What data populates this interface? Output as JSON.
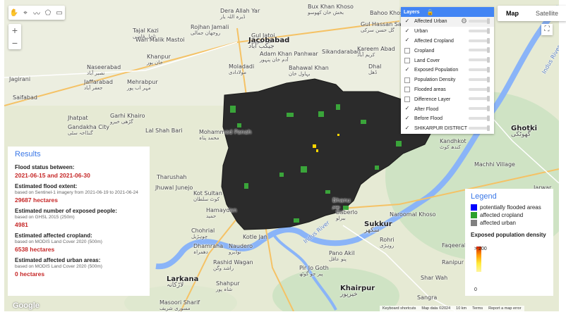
{
  "map": {
    "places": [
      {
        "en": "Dera Allah Yar",
        "ur": "ڈیرہ اللہ یار"
      },
      {
        "en": "Rojhan Jamali",
        "ur": "روجھان جمالی"
      },
      {
        "en": "Gul Jatoi",
        "ur": "گل جتوئی"
      },
      {
        "en": "Jacobabad",
        "ur": "جیکب آباد"
      },
      {
        "en": "Adam Khan Panhwar",
        "ur": "آدم خان پنہور"
      },
      {
        "en": "Moladadi",
        "ur": "مولادادی"
      },
      {
        "en": "Bahawal Khan",
        "ur": "بہاول خان"
      },
      {
        "en": "Sikandarabad",
        "ur": ""
      },
      {
        "en": "Kareem Abad",
        "ur": "کریم آباد"
      },
      {
        "en": "Dhal",
        "ur": "ڈھل"
      },
      {
        "en": "Bux Khan Khoso",
        "ur": "بخش خان کھوسو"
      },
      {
        "en": "Bahoo Khosa",
        "ur": ""
      },
      {
        "en": "Gul Hassan Sarki",
        "ur": "گل حسن سرکی"
      },
      {
        "en": "Tajal Kazi",
        "ur": "تاجل قاضی"
      },
      {
        "en": "Wah Malik Mastoi",
        "ur": ""
      },
      {
        "en": "Khanpur",
        "ur": "خان پور"
      },
      {
        "en": "Naseerabad",
        "ur": "نصیر آباد"
      },
      {
        "en": "Jaffarabad",
        "ur": "جعفر آباد"
      },
      {
        "en": "Mehrabpur",
        "ur": "مہر اب پور"
      },
      {
        "en": "Jagirani",
        "ur": ""
      },
      {
        "en": "Saifabad",
        "ur": ""
      },
      {
        "en": "Garhi Khairo",
        "ur": "گڑھی خیرو"
      },
      {
        "en": "Gandakha City",
        "ur": "گنڈاخہ سٹی"
      },
      {
        "en": "Jhatpat",
        "ur": ""
      },
      {
        "en": "Lal Shah Bari",
        "ur": ""
      },
      {
        "en": "Mohammad Panah",
        "ur": "محمد پناہ"
      },
      {
        "en": "Tharushah",
        "ur": ""
      },
      {
        "en": "Jhuwal Junejo",
        "ur": ""
      },
      {
        "en": "Kot Sultan",
        "ur": "کوٹ سلطان"
      },
      {
        "en": "Hamaydan",
        "ur": "حمید"
      },
      {
        "en": "Dhamraha",
        "ur": "دھمراہ"
      },
      {
        "en": "Chohrial",
        "ur": "چوہڑیل"
      },
      {
        "en": "Kotle Jan",
        "ur": ""
      },
      {
        "en": "Naudero",
        "ur": "نوڈیرو"
      },
      {
        "en": "Rashid Wagan",
        "ur": "راشد وگن"
      },
      {
        "en": "Larkana",
        "ur": "لاڑکانہ"
      },
      {
        "en": "Shahpur",
        "ur": "شاہ پور"
      },
      {
        "en": "Masoori Sharif",
        "ur": "مسوری شریف"
      },
      {
        "en": "Sukkur",
        "ur": "سکھر"
      },
      {
        "en": "Rohri",
        "ur": "روہڑی"
      },
      {
        "en": "Pano Akil",
        "ur": "پنو عاقل"
      },
      {
        "en": "Pir Jo Goth",
        "ur": "پیر جو گوٹھ"
      },
      {
        "en": "Khairpur",
        "ur": "خیرپور"
      },
      {
        "en": "Naroomal Khoso",
        "ur": ""
      },
      {
        "en": "Faqeerabad",
        "ur": ""
      },
      {
        "en": "Ghotki",
        "ur": "گھوٹکی"
      },
      {
        "en": "Machhi Village",
        "ur": ""
      },
      {
        "en": "Jarwar",
        "ur": ""
      },
      {
        "en": "Ranipur",
        "ur": ""
      },
      {
        "en": "Shar Wah",
        "ur": ""
      },
      {
        "en": "Sangra",
        "ur": ""
      },
      {
        "en": "Kandhkot",
        "ur": "کندھ کوٹ"
      },
      {
        "en": "Bhanu",
        "ur": "بھنو"
      },
      {
        "en": "Baberlo",
        "ur": "ببرلو"
      }
    ],
    "roads": [
      "N65",
      "N55",
      "N65",
      "N105",
      "N55"
    ],
    "river_label": "Indus River",
    "footer": {
      "shortcuts": "Keyboard shortcuts",
      "data": "Map data ©2024",
      "scale": "10 km",
      "terms": "Terms",
      "report": "Report a map error"
    },
    "logo": "Google"
  },
  "controls": {
    "zoom_in": "+",
    "zoom_out": "−",
    "map_label": "Map",
    "satellite_label": "Satellite"
  },
  "layers": {
    "title": "Layers",
    "items": [
      {
        "label": "Affected Urban",
        "checked": true
      },
      {
        "label": "Urban",
        "checked": true
      },
      {
        "label": "Affected Cropland",
        "checked": true
      },
      {
        "label": "Cropland",
        "checked": false
      },
      {
        "label": "Land Cover",
        "checked": false
      },
      {
        "label": "Exposed Population",
        "checked": true
      },
      {
        "label": "Population Density",
        "checked": false
      },
      {
        "label": "Flooded areas",
        "checked": false
      },
      {
        "label": "Difference Layer",
        "checked": false
      },
      {
        "label": "After Flood",
        "checked": true
      },
      {
        "label": "Before Flood",
        "checked": true
      },
      {
        "label": "SHIKARPUR DISTRICT",
        "checked": true
      }
    ]
  },
  "results": {
    "title": "Results",
    "flood_status_label": "Flood status between:",
    "flood_status_value": "2021-06-15 and 2021-06-30",
    "extent_label": "Estimated flood extent:",
    "extent_sub": "based on Sentinel-1 imagery from 2021-06-19 to 2021-06-24",
    "extent_value": "29687 hectares",
    "people_label": "Estimated number of exposed people:",
    "people_sub": "based on GHSL 2015 (250m)",
    "people_value": "4981",
    "cropland_label": "Estimated affected cropland:",
    "cropland_sub": "based on MODIS Land Cover 2020 (500m)",
    "cropland_value": "6538 hectares",
    "urban_label": "Estimated affected urban areas:",
    "urban_sub": "based on MODIS Land Cover 2020 (500m)",
    "urban_value": "0 hectares"
  },
  "legend": {
    "title": "Legend",
    "items": [
      {
        "label": "potentially flooded areas",
        "color": "#0000ff"
      },
      {
        "label": "affected cropland",
        "color": "#2ca02c"
      },
      {
        "label": "affected urban",
        "color": "#808080"
      }
    ],
    "density_title": "Exposed population density",
    "max_label": "> 200",
    "min_label": "0"
  }
}
